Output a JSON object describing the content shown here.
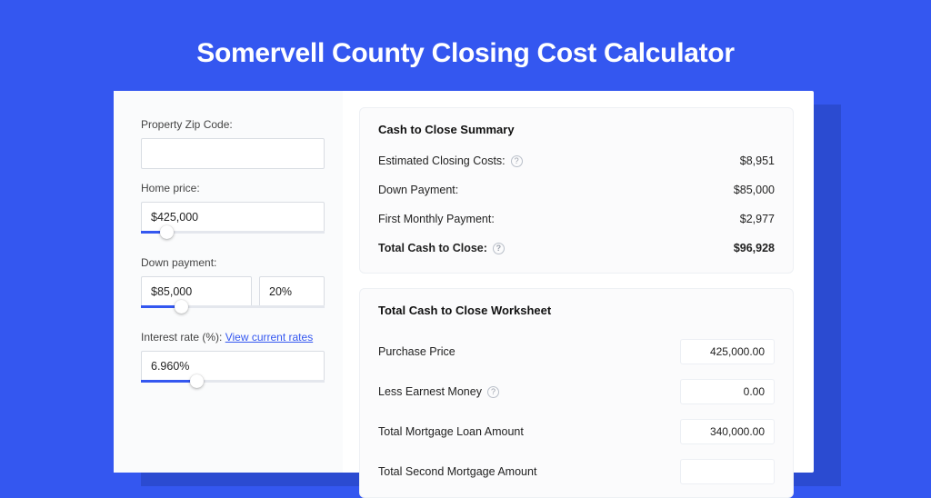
{
  "title": "Somervell County Closing Cost Calculator",
  "left": {
    "zip_label": "Property Zip Code:",
    "zip_value": "",
    "home_price_label": "Home price:",
    "home_price_value": "$425,000",
    "down_payment_label": "Down payment:",
    "down_payment_value": "$85,000",
    "down_payment_pct": "20%",
    "interest_label_prefix": "Interest rate (%): ",
    "interest_link": "View current rates",
    "interest_value": "6.960%"
  },
  "summary": {
    "heading": "Cash to Close Summary",
    "rows": [
      {
        "label": "Estimated Closing Costs:",
        "help": true,
        "value": "$8,951"
      },
      {
        "label": "Down Payment:",
        "help": false,
        "value": "$85,000"
      },
      {
        "label": "First Monthly Payment:",
        "help": false,
        "value": "$2,977"
      }
    ],
    "total_label": "Total Cash to Close:",
    "total_value": "$96,928"
  },
  "worksheet": {
    "heading": "Total Cash to Close Worksheet",
    "rows": [
      {
        "label": "Purchase Price",
        "help": false,
        "value": "425,000.00"
      },
      {
        "label": "Less Earnest Money",
        "help": true,
        "value": "0.00"
      },
      {
        "label": "Total Mortgage Loan Amount",
        "help": false,
        "value": "340,000.00"
      },
      {
        "label": "Total Second Mortgage Amount",
        "help": false,
        "value": ""
      }
    ]
  },
  "sliders": {
    "home_price_fill_pct": 14,
    "down_payment_fill_pct": 22,
    "interest_fill_pct": 30
  }
}
